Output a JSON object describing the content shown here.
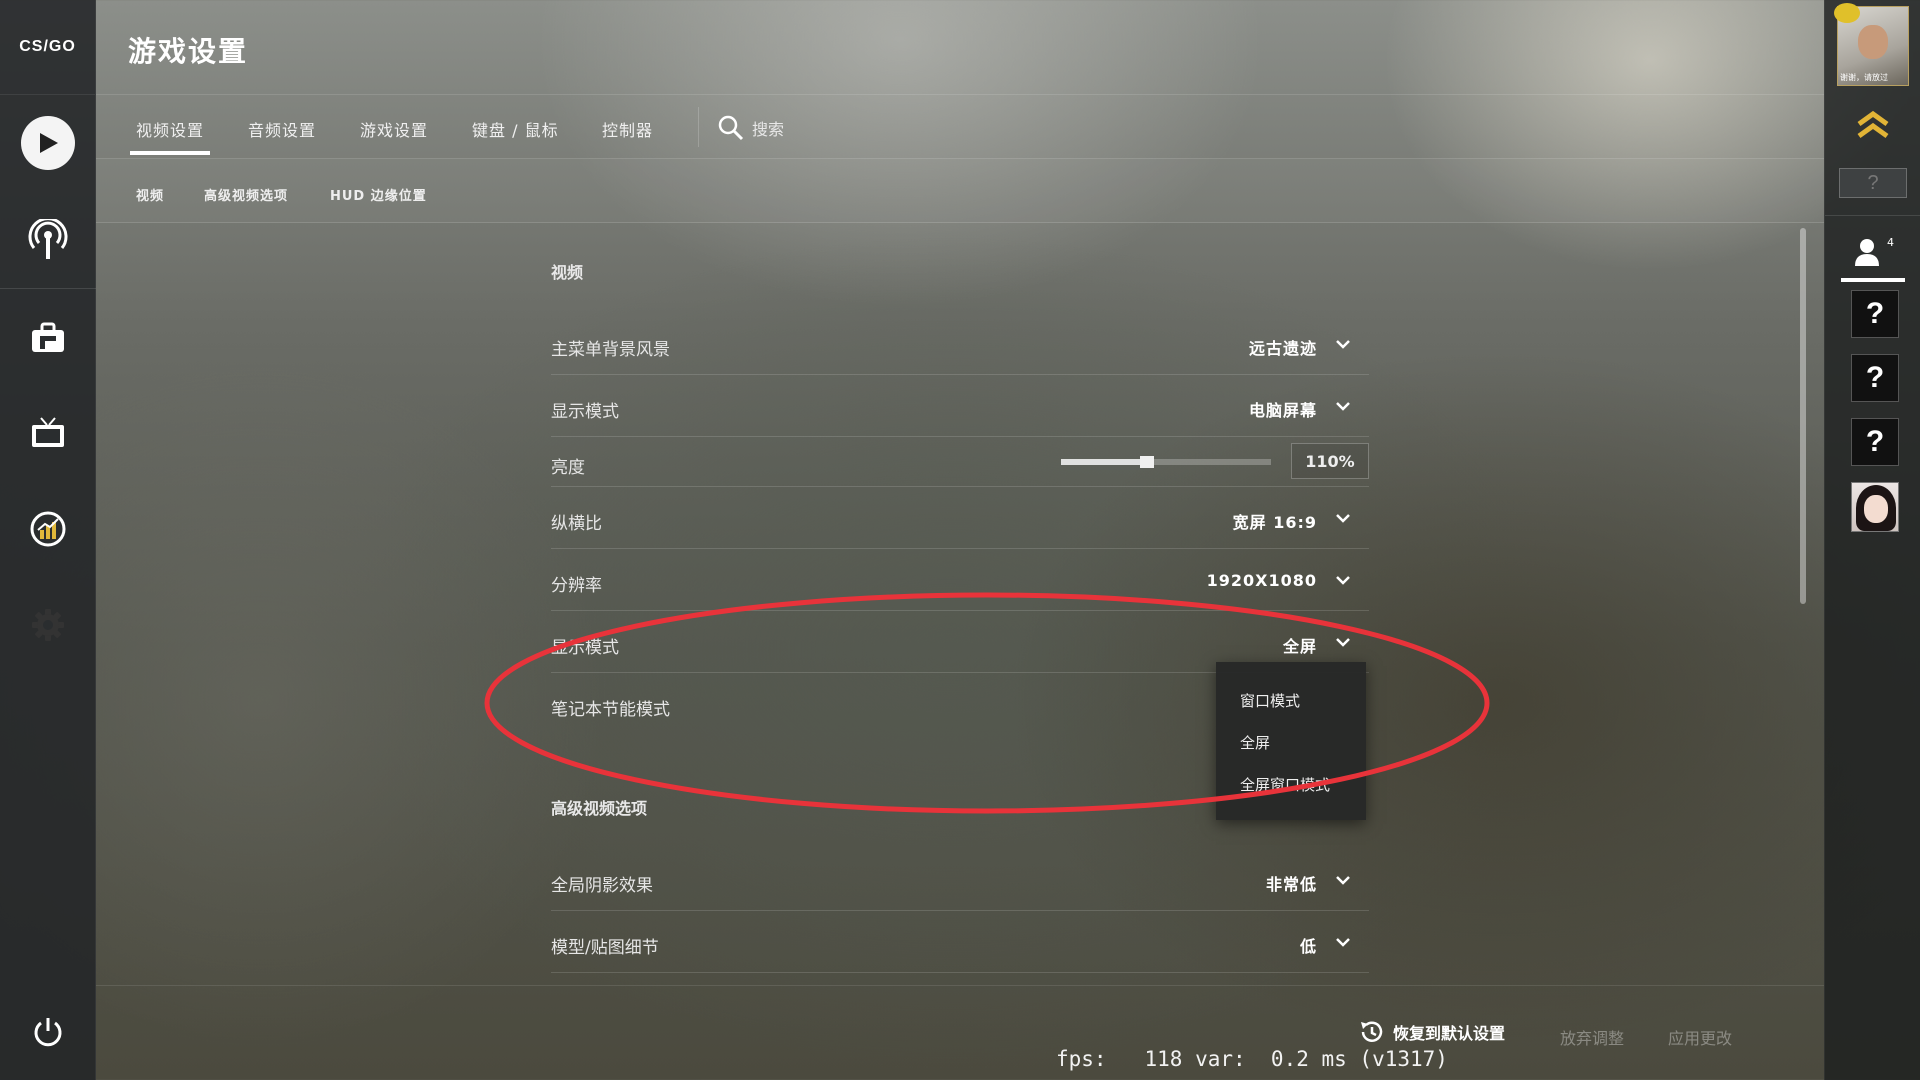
{
  "app": {
    "logo_text": "CS/GO"
  },
  "header": {
    "title": "游戏设置"
  },
  "tabs": [
    {
      "label": "视频设置",
      "active": true
    },
    {
      "label": "音频设置"
    },
    {
      "label": "游戏设置"
    },
    {
      "label": "键盘 / 鼠标"
    },
    {
      "label": "控制器"
    }
  ],
  "search": {
    "label": "搜索"
  },
  "subtabs": [
    "视频",
    "高级视频选项",
    "HUD 边缘位置"
  ],
  "sections": {
    "video_title": "视频",
    "advanced_title": "高级视频选项"
  },
  "settings": {
    "menu_background": {
      "label": "主菜单背景风景",
      "value": "远古遗迹"
    },
    "color_mode": {
      "label": "显示模式",
      "value": "电脑屏幕"
    },
    "brightness": {
      "label": "亮度",
      "value": "110%",
      "slider_fraction": 0.41
    },
    "aspect_ratio": {
      "label": "纵横比",
      "value": "宽屏 16:9"
    },
    "resolution": {
      "label": "分辨率",
      "value": "1920X1080"
    },
    "display_mode": {
      "label": "显示模式",
      "value": "全屏"
    },
    "laptop_power": {
      "label": "笔记本节能模式"
    },
    "global_shadow": {
      "label": "全局阴影效果",
      "value": "非常低"
    },
    "model_texture": {
      "label": "模型/贴图细节",
      "value": "低"
    }
  },
  "dropdown": {
    "options": [
      "窗口模式",
      "全屏",
      "全屏窗口模式"
    ]
  },
  "footer": {
    "reset_label": "恢复到默认设置",
    "discard_label": "放弃调整",
    "apply_label": "应用更改",
    "fps_text": "fps:   118 var:  0.2 ms (v1317)"
  },
  "right_panel": {
    "profile_caption": "谢谢，请放过",
    "rank_placeholder": "?",
    "friends_count": "4",
    "friends": [
      "?",
      "?",
      "?"
    ]
  },
  "colors": {
    "annotation_red": "#e8333a",
    "accent_white": "#ffffff"
  },
  "icons": [
    "play-icon",
    "broadcast-icon",
    "inventory-icon",
    "watch-icon",
    "stats-icon",
    "gear-icon",
    "power-icon",
    "search-icon",
    "restore-icon",
    "chevron-down-icon",
    "rank-chevron-icon",
    "friends-icon"
  ]
}
